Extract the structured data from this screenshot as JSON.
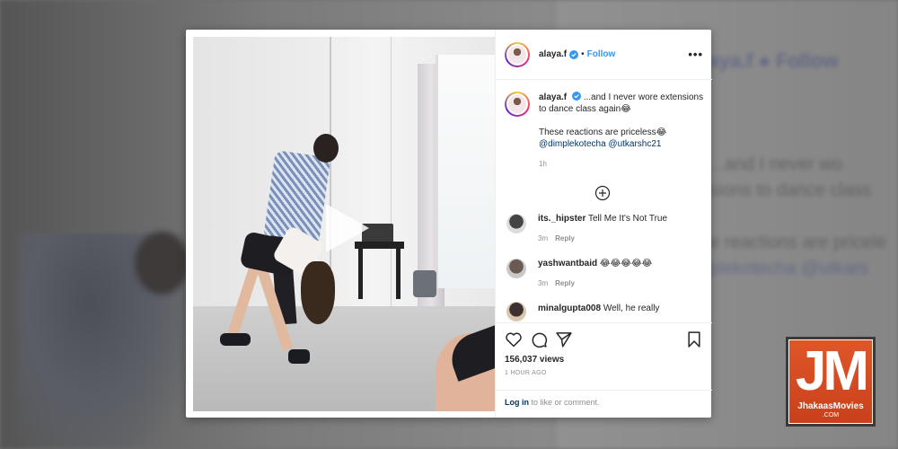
{
  "background": {
    "username": "alaya.f",
    "follow": "Follow",
    "caption_fragment_1": "...and I never wo",
    "caption_fragment_2": "sions to dance class",
    "caption_fragment_3": "e reactions are pricele",
    "caption_fragment_4": "plekotecha @utkars"
  },
  "post": {
    "header": {
      "username": "alaya.f",
      "separator": "•",
      "follow_label": "Follow",
      "more_label": "•••"
    },
    "caption": {
      "username": "alaya.f",
      "text_1": "...and I never wore extensions to dance class again😂",
      "text_2": "These reactions are priceless😂",
      "mention_1": "@dimplekotecha",
      "mention_2": "@utkarshc21",
      "time": "1h"
    },
    "comments": [
      {
        "username": "its._hipster",
        "text": "Tell Me It's Not True",
        "time": "3m",
        "reply": "Reply"
      },
      {
        "username": "yashwantbaid",
        "text": "😂😂😂😂😂",
        "time": "3m",
        "reply": "Reply"
      },
      {
        "username": "minalgupta008",
        "text": "Well, he really"
      }
    ],
    "views": "156,037 views",
    "posted_ago": "1 HOUR AGO",
    "login": {
      "link": "Log in",
      "rest": " to like or comment."
    }
  },
  "watermark": {
    "letters": "JM",
    "brand": "JhakaasMovies",
    "domain": ".COM"
  },
  "colors": {
    "link_blue": "#3897f0",
    "mention_blue": "#003569",
    "logo_orange": "#e0562a"
  },
  "icons": [
    "play-icon",
    "verified-icon",
    "more-icon",
    "load-more-icon",
    "heart-icon",
    "comment-icon",
    "share-icon",
    "bookmark-icon"
  ]
}
